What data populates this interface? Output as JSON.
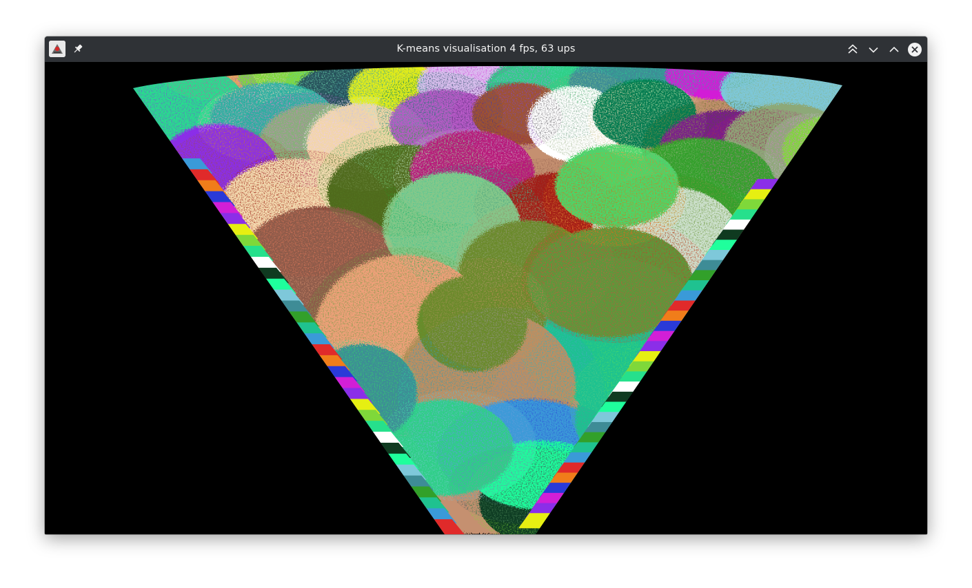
{
  "window": {
    "title": "K-means visualisation 4 fps, 63 ups"
  },
  "titlebar": {
    "app_icon": "java-app-icon",
    "pin_icon": "pin-icon",
    "buttons": [
      {
        "name": "keep-above-button",
        "icon": "double-chevron-up-icon"
      },
      {
        "name": "minimize-button",
        "icon": "chevron-down-icon"
      },
      {
        "name": "maximize-button",
        "icon": "chevron-up-icon"
      },
      {
        "name": "close-button",
        "icon": "close-circle-icon"
      }
    ]
  },
  "visualisation": {
    "background": "#000000",
    "palette": [
      "#e8a85c",
      "#7fd83a",
      "#27505a",
      "#e6ef12",
      "#dcc0f0",
      "#2fcf86",
      "#3e8c96",
      "#d21fd6",
      "#7ec8da",
      "#26e08c",
      "#2bb0a0",
      "#87b07a",
      "#8b2ee8",
      "#f3d6a8",
      "#b85ac8",
      "#a0522d",
      "#ffffff",
      "#007a50",
      "#7a1a8c",
      "#8ea878",
      "#f5deb3",
      "#4f6a1a",
      "#b8177a",
      "#a31a12",
      "#32a02a",
      "#cfe2d0",
      "#8c5a4a",
      "#86c88a",
      "#6b8a2a",
      "#f0a07a",
      "#1fc290",
      "#c08e5e",
      "#5a9a3a",
      "#4ad86a",
      "#3a9ad8",
      "#e02a2a",
      "#f07d1a",
      "#2a3ad8",
      "#0f3a20",
      "#1fff9c"
    ]
  }
}
